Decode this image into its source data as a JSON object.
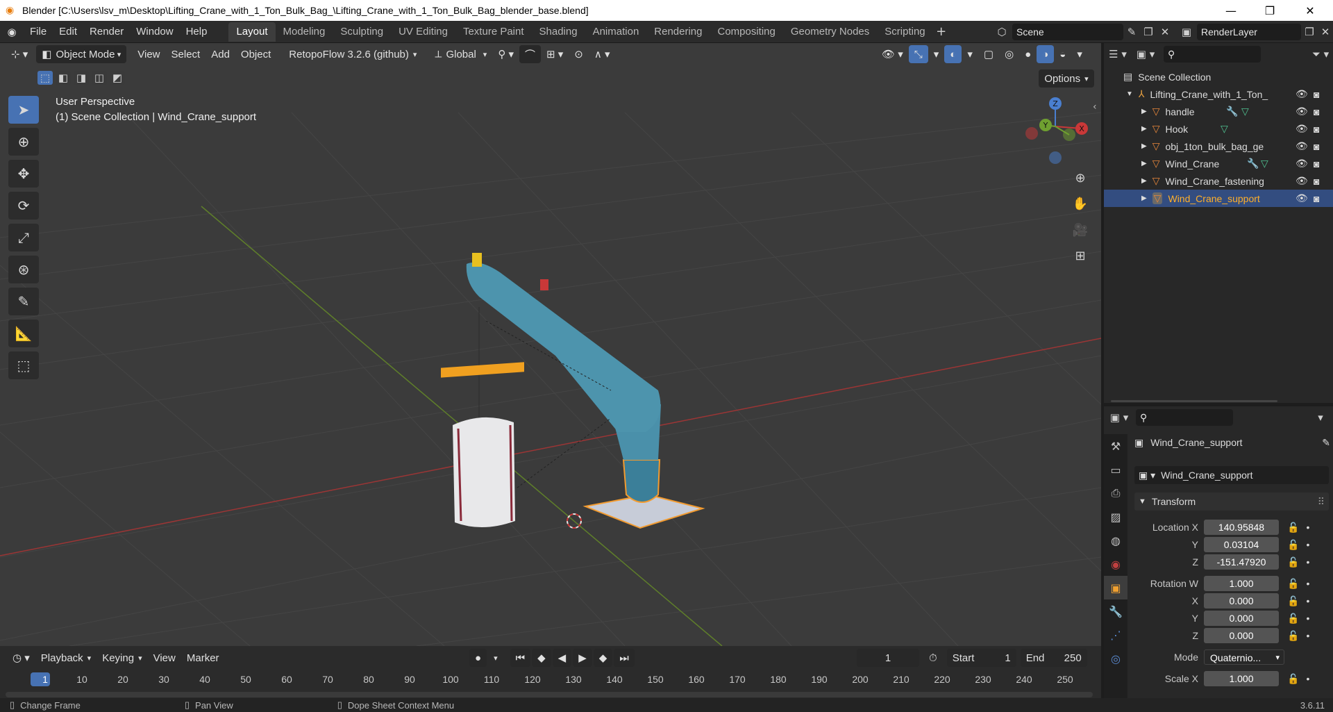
{
  "window": {
    "title": "Blender [C:\\Users\\lsv_m\\Desktop\\Lifting_Crane_with_1_Ton_Bulk_Bag_\\Lifting_Crane_with_1_Ton_Bulk_Bag_blender_base.blend]"
  },
  "menu": [
    "File",
    "Edit",
    "Render",
    "Window",
    "Help"
  ],
  "workspaces": [
    "Layout",
    "Modeling",
    "Sculpting",
    "UV Editing",
    "Texture Paint",
    "Shading",
    "Animation",
    "Rendering",
    "Compositing",
    "Geometry Nodes",
    "Scripting"
  ],
  "scene": {
    "name": "Scene",
    "view_layer": "RenderLayer"
  },
  "viewport": {
    "mode": "Object Mode",
    "menu": [
      "View",
      "Select",
      "Add",
      "Object"
    ],
    "addon": "RetopoFlow 3.2.6 (github)",
    "orientation": "Global",
    "options_label": "Options",
    "perspective": "User Perspective",
    "collection_info": "(1) Scene Collection | Wind_Crane_support",
    "gizmo": {
      "x": "X",
      "y": "Y",
      "z": "Z"
    }
  },
  "outliner": {
    "root": "Scene Collection",
    "collection": "Lifting_Crane_with_1_Ton_",
    "items": [
      "handle",
      "Hook",
      "obj_1ton_bulk_bag_ge",
      "Wind_Crane",
      "Wind_Crane_fastening",
      "Wind_Crane_support"
    ]
  },
  "properties": {
    "object_name": "Wind_Crane_support",
    "data_name": "Wind_Crane_support",
    "transform_label": "Transform",
    "location_x_label": "Location X",
    "location_x": "140.95848",
    "location_y_label": "Y",
    "location_y": "0.03104",
    "location_z_label": "Z",
    "location_z": "-151.47920",
    "rotation_w_label": "Rotation W",
    "rotation_w": "1.000",
    "rotation_x_label": "X",
    "rotation_x": "0.000",
    "rotation_y_label": "Y",
    "rotation_y": "0.000",
    "rotation_z_label": "Z",
    "rotation_z": "0.000",
    "mode_label": "Mode",
    "mode": "Quaternio...",
    "scale_x_label": "Scale X",
    "scale_x": "1.000"
  },
  "timeline": {
    "menu": [
      "Playback",
      "Keying",
      "View",
      "Marker"
    ],
    "current_frame": "1",
    "start_label": "Start",
    "start": "1",
    "end_label": "End",
    "end": "250",
    "ticks": [
      "1",
      "10",
      "20",
      "30",
      "40",
      "50",
      "60",
      "70",
      "80",
      "90",
      "100",
      "110",
      "120",
      "130",
      "140",
      "150",
      "160",
      "170",
      "180",
      "190",
      "200",
      "210",
      "220",
      "230",
      "240",
      "250"
    ]
  },
  "status": {
    "left": "Change Frame",
    "middle": "Pan View",
    "right": "Dope Sheet Context Menu",
    "version": "3.6.11"
  }
}
